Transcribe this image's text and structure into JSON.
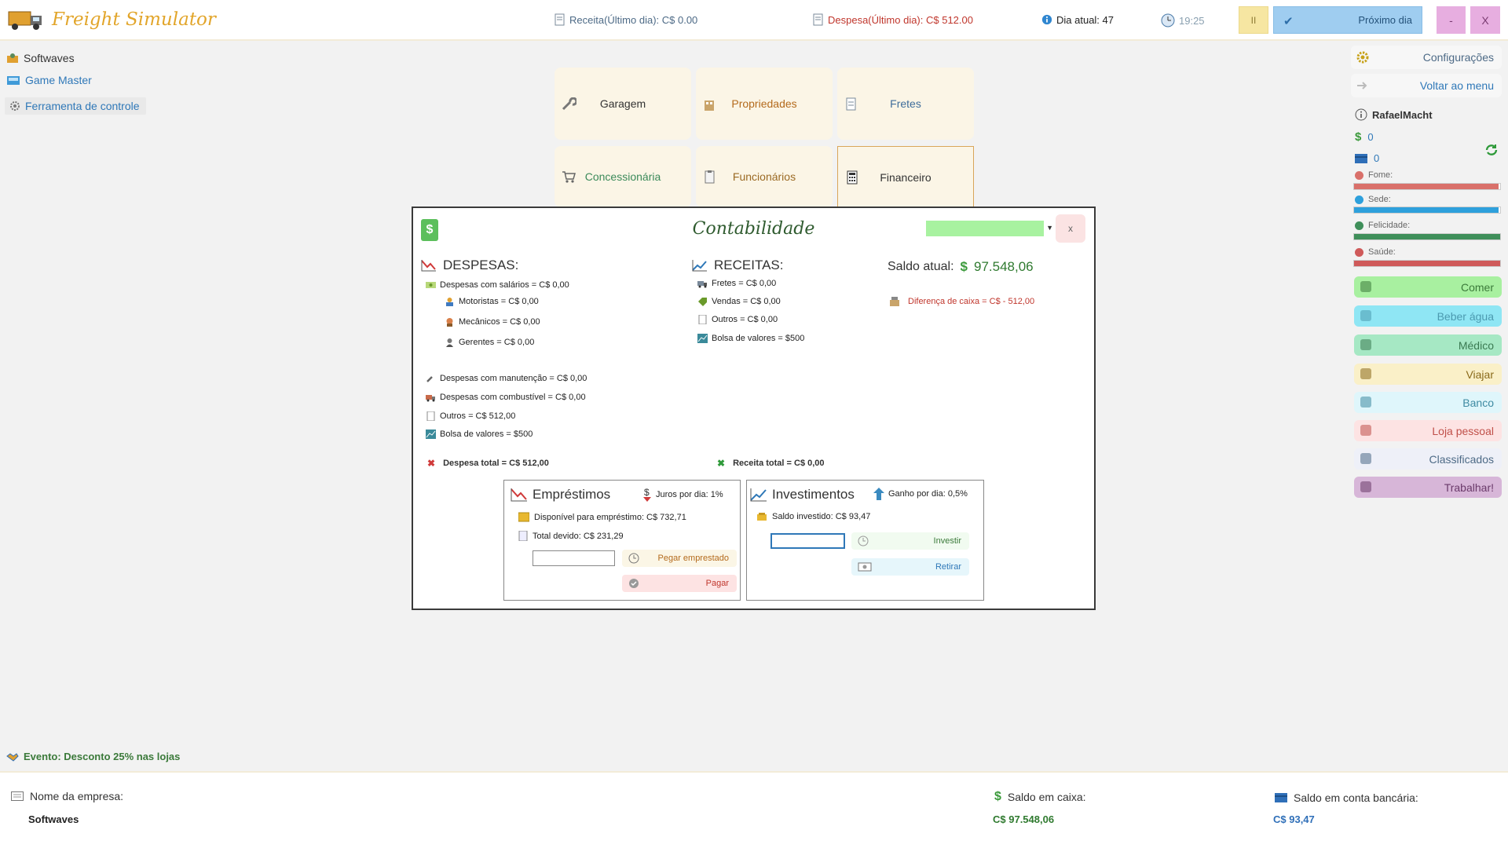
{
  "app": {
    "title": "Freight Simulator"
  },
  "topbar": {
    "revenue": "Receita(Último dia): C$  0.00",
    "expense": "Despesa(Último dia): C$  512.00",
    "day": "Dia atual: 47",
    "time": "19:25",
    "pause_label": "II",
    "next_day_label": "Próximo dia",
    "minimize_label": "-",
    "close_label": "X"
  },
  "sidebar": {
    "items": [
      {
        "label": "Softwaves"
      },
      {
        "label": "Game Master"
      },
      {
        "label": "Ferramenta de controle"
      }
    ]
  },
  "nav": {
    "tiles": [
      {
        "label": "Garagem"
      },
      {
        "label": "Propriedades"
      },
      {
        "label": "Fretes"
      },
      {
        "label": "Concessionária"
      },
      {
        "label": "Funcionários"
      },
      {
        "label": "Financeiro"
      }
    ]
  },
  "modal": {
    "title": "Contabilidade",
    "close_label": "x",
    "expenses": {
      "title": "DESPESAS:",
      "salaries": "Despesas com salários = C$ 0,00",
      "drivers": "Motoristas = C$ 0,00",
      "mechanics": "Mecânicos = C$ 0,00",
      "managers": "Gerentes = C$ 0,00",
      "maintenance": "Despesas com manutenção = C$ 0,00",
      "fuel": "Despesas com combustível = C$ 0,00",
      "others": "Outros = C$ 512,00",
      "stocks": "Bolsa de valores = $500",
      "total": "Despesa total = C$ 512,00"
    },
    "revenues": {
      "title": "RECEITAS:",
      "freight": "Fretes = C$ 0,00",
      "sales": "Vendas = C$ 0,00",
      "others": "Outros = C$ 0,00",
      "stocks": "Bolsa de valores = $500",
      "total": "Receita total = C$ 0,00"
    },
    "balance": {
      "label": "Saldo atual:",
      "value": "97.548,06",
      "diff": "Diferença de caixa = C$ - 512,00"
    },
    "loans": {
      "title": "Empréstimos",
      "rate": "Juros por dia: 1%",
      "available": "Disponível para empréstimo: C$ 732,71",
      "owed": "Total devido: C$ 231,29",
      "input_value": "",
      "borrow_label": "Pegar emprestado",
      "pay_label": "Pagar"
    },
    "investments": {
      "title": "Investimentos",
      "rate": "Ganho por dia: 0,5%",
      "invested": "Saldo investido: C$ 93,47",
      "input_value": "",
      "invest_label": "Investir",
      "withdraw_label": "Retirar"
    }
  },
  "right_panel": {
    "config_label": "Configurações",
    "back_label": "Voltar ao menu",
    "user": "RafaelMacht",
    "cash": "0",
    "bank": "0",
    "stats": [
      {
        "label": "Fome:",
        "value": 0.99,
        "color": "#d9706a"
      },
      {
        "label": "Sede:",
        "value": 0.99,
        "color": "#2ea0dc"
      },
      {
        "label": "Felicidade:",
        "value": 1.0,
        "color": "#3f8f5a"
      },
      {
        "label": "Saúde:",
        "value": 1.0,
        "color": "#cf5a5a"
      }
    ],
    "actions": [
      {
        "label": "Comer",
        "color": "#a8f0a0",
        "text": "#3b7a3a",
        "icon": "food-icon"
      },
      {
        "label": "Beber água",
        "color": "#8fe6f4",
        "text": "#4c9ab0",
        "icon": "water-icon"
      },
      {
        "label": "Médico",
        "color": "#a6e8c4",
        "text": "#3b7a52",
        "icon": "doctor-icon"
      },
      {
        "label": "Viajar",
        "color": "#faf0c8",
        "text": "#8a6a1a",
        "icon": "suitcase-icon"
      },
      {
        "label": "Banco",
        "color": "#dff6fb",
        "text": "#3e8aa2",
        "icon": "bank-icon"
      },
      {
        "label": "Loja pessoal",
        "color": "#fde3e3",
        "text": "#c0504a",
        "icon": "shop-icon"
      },
      {
        "label": "Classificados",
        "color": "#eef0f8",
        "text": "#4d6a86",
        "icon": "classifieds-icon"
      },
      {
        "label": "Trabalhar!",
        "color": "#d7b6d8",
        "text": "#6a3a6a",
        "icon": "work-icon"
      }
    ]
  },
  "event": {
    "text": "Evento: Desconto 25% nas lojas"
  },
  "footer": {
    "company_label": "Nome da empresa:",
    "company_value": "Softwaves",
    "cash_label": "Saldo em caixa:",
    "cash_value": "C$  97.548,06",
    "bank_label": "Saldo em conta bancária:",
    "bank_value": "C$  93,47"
  }
}
